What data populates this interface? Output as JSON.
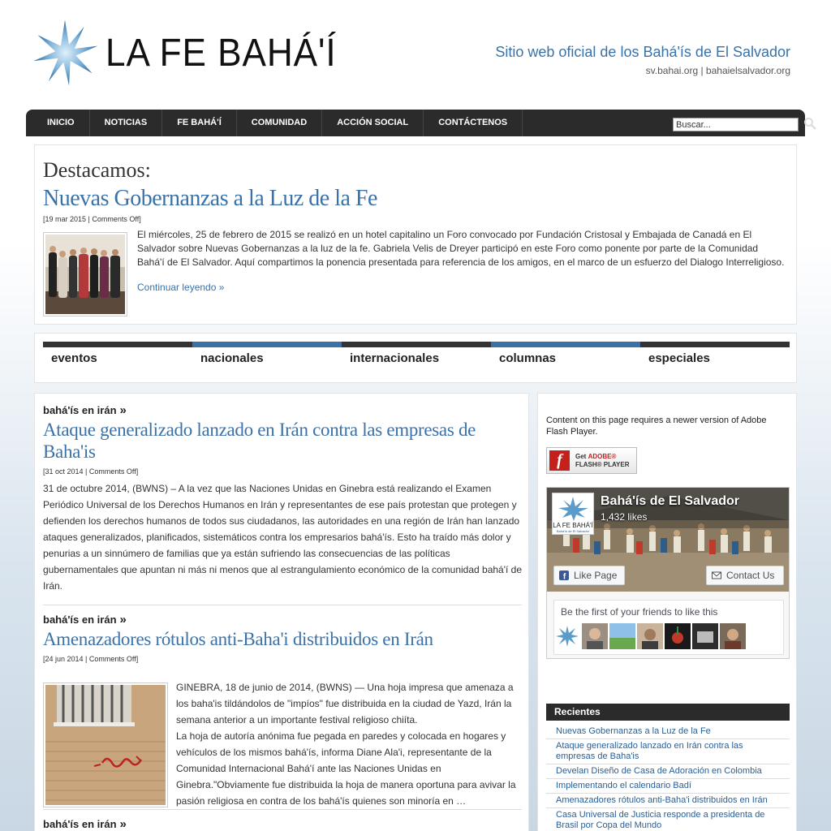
{
  "header": {
    "logo_text": "LA FE BAHÁ'Í",
    "tagline": "Sitio web oficial de los Bahá'ís de El Salvador",
    "urls": "sv.bahai.org | bahaielsalvador.org"
  },
  "nav": {
    "items": [
      "INICIO",
      "NOTICIAS",
      "FE BAHÁ'Í",
      "COMUNIDAD",
      "ACCIÓN SOCIAL",
      "CONTÁCTENOS"
    ],
    "search_placeholder": "Buscar..."
  },
  "featured": {
    "heading": "Destacamos:",
    "title": "Nuevas Gobernanzas a la Luz de la Fe",
    "meta": "[19 mar 2015 | Comments Off]",
    "excerpt": "El miércoles, 25 de febrero de 2015 se realizó en un hotel capitalino un Foro convocado por Fundación Cristosal y Embajada de Canadá en El Salvador sobre Nuevas Gobernanzas a la luz de la fe. Gabriela Velis de Dreyer participó en este Foro como ponente por parte de la Comunidad Bahá'í de El Salvador. Aquí compartimos la ponencia presentada para referencia de los amigos, en el marco de un esfuerzo del Dialogo Interreligioso.",
    "more": "Continuar leyendo »"
  },
  "tabs": [
    "eventos",
    "nacionales",
    "internacionales",
    "columnas",
    "especiales"
  ],
  "posts": [
    {
      "category": "bahá'ís en irán",
      "arrow": "»",
      "title": "Ataque generalizado lanzado en Irán contra las empresas de Baha'is",
      "meta": "[31 oct 2014 | Comments Off]",
      "body": "31 de octubre 2014, (BWNS) – A la vez que las Naciones Unidas en Ginebra está realizando el Examen Periódico Universal de los Derechos Humanos en Irán y representantes de ese país protestan que protegen y defienden los derechos humanos de todos sus ciudadanos, las autoridades en una región de Irán han lanzado ataques generalizados, planificados, sistemáticos contra los empresarios bahá'ís. Esto ha traído más dolor y penurias a un sinnúmero de familias que ya están sufriendo las consecuencias de las políticas gubernamentales que apuntan ni más ni menos que al estrangulamiento económico de la comunidad bahá'í de Irán."
    },
    {
      "category": "bahá'ís en irán",
      "arrow": "»",
      "title": "Amenazadores rótulos anti-Baha'i distribuidos en Irán",
      "meta": "[24 jun 2014 | Comments Off]",
      "body1": "GINEBRA, 18 de junio de 2014, (BWNS) — Una hoja impresa que amenaza a los baha'is tildándolos de \"impíos\" fue distribuida en la ciudad de Yazd, Irán la semana anterior a un importante festival religioso chiíta.",
      "body2": "La hoja de autoría anónima fue pegada en paredes y colocada en hogares y vehículos de los mismos bahá'ís, informa Diane Ala'i, representante de la Comunidad Internacional Bahá'í ante las Naciones Unidas en Ginebra.\"Obviamente fue distribuida la hoja de manera oportuna para avivar la pasión religiosa en contra de los bahá'ís quienes son minoría en …"
    },
    {
      "category": "bahá'ís en irán",
      "arrow": "»"
    }
  ],
  "sidebar": {
    "flash_message": "Content on this page requires a newer version of Adobe Flash Player.",
    "flash_button_line1_prefix": "Get ",
    "flash_button_line1_brand": "ADOBE®",
    "flash_button_line2": "FLASH® PLAYER",
    "facebook": {
      "page_name": "Bahá'ís de El Salvador",
      "likes": "1,432 likes",
      "like_button": "Like Page",
      "contact_button": "Contact Us",
      "friends_text": "Be the first of your friends to like this"
    },
    "recent_title": "Recientes",
    "recent_items": [
      "Nuevas Gobernanzas a la Luz de la Fe",
      "Ataque generalizado lanzado en Irán contra las empresas de Baha'is",
      "Develan Diseño de Casa de Adoración en Colombia",
      "Implementando el calendario Badí",
      "Amenazadores rótulos anti-Baha'i distribuidos en Irán",
      "Casa Universal de Justicia responde a presidenta de Brasil por Copa del Mundo"
    ]
  },
  "colors": {
    "link_blue": "#3a72a8",
    "nav_bg": "#2b2b2b",
    "facebook_blue": "#3b5998",
    "flash_red": "#c4211c"
  }
}
